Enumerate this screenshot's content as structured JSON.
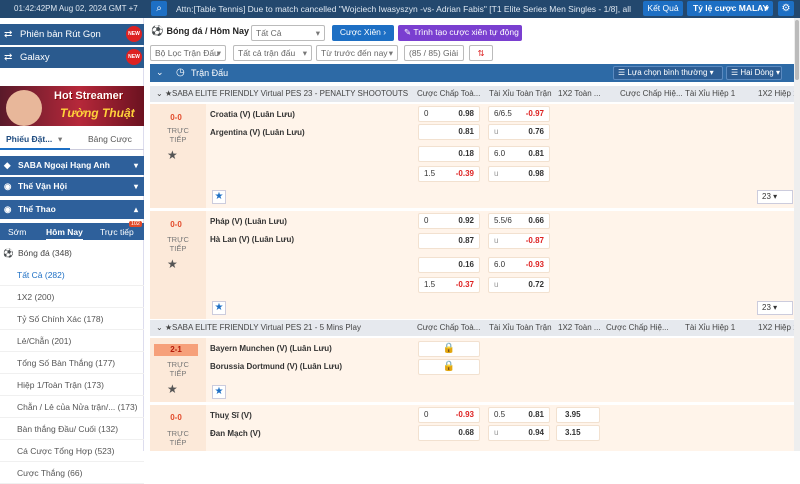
{
  "topbar": {
    "clock": "01:42:42PM Aug 02, 2024 GMT +7",
    "ticker": "Attn:[Table Tennis] Due to match cancelled \"Wojciech Iwasyszyn -vs- Adrian Fabis\" [T1 Elite Series Men Singles - 1/8], all",
    "result_label": "Kết Quả",
    "odds_label": "Tỷ lệ cược MALAY"
  },
  "sidebar": {
    "promo1": "Phiên bản Rút Gọn",
    "promo1_badge": "NEW",
    "promo2": "Galaxy",
    "promo2_badge": "NEW",
    "banner_line1": "Hot Streamer",
    "banner_line2": "Tường Thuật",
    "slip_tab": "Phiếu Đặt...",
    "bet_tab": "Bảng Cược",
    "sections": [
      "SABA Ngoại Hạng Anh",
      "Thế Vận Hội",
      "Thể Thao"
    ],
    "time_tabs": [
      "Sớm",
      "Hôm Nay",
      "Trực tiếp"
    ],
    "live_count": "102",
    "sport": "Bóng đá",
    "sport_count": "(348)",
    "markets": [
      "Tất Cả (282)",
      "1X2 (200)",
      "Tỷ Số Chính Xác (178)",
      "Lẻ/Chẵn (201)",
      "Tổng Số Bàn Thắng (177)",
      "Hiệp 1/Toàn Trận (173)",
      "Chẵn / Lẻ của Nửa trận/... (173)",
      "Bàn thắng Đầu/ Cuối (132)",
      "Cá Cược Tổng Hợp (523)",
      "Cược Thắng (66)"
    ]
  },
  "main": {
    "crumb": "Bóng đá / Hôm Nay",
    "filter_all": "Tất Cả",
    "combo_btn": "Cược Xiên",
    "auto_combo_btn": "Trình tạo cược xiên tự động",
    "filter_league": "Bộ Lọc Trận Đấu",
    "filter_type": "Tất cả trận đấu",
    "filter_sort": "Từ trước đến nay",
    "game_count": "(85 / 85) Giải",
    "header_title": "Trận Đấu",
    "select_normal": "Lựa chọn bình thường",
    "two_lines": "Hai Dòng",
    "columns": [
      "Cược Chấp Toà...",
      "Tài Xỉu Toàn Trận",
      "1X2 Toàn ...",
      "Cược Chấp Hiệ...",
      "Tài Xỉu Hiệp 1",
      "1X2 Hiệp 1"
    ],
    "more_count": "23"
  },
  "leagues": [
    {
      "name": "SABA ELITE FRIENDLY Virtual PES 23 - PENALTY SHOOTOUTS",
      "matches": [
        {
          "score": "0-0",
          "live": "TRỰC TIẾP",
          "home": "Croatia (V) (Luân Lưu)",
          "away": "Argentina (V) (Luân Lưu)",
          "rows": [
            {
              "hdp_line": "0",
              "hdp_odds": "0.98",
              "ou_line": "6/6.5",
              "ou_odds": "-0.97"
            },
            {
              "hdp_line": "",
              "hdp_odds": "0.81",
              "ou_line": "u",
              "ou_odds": "0.76"
            },
            {
              "hdp_line": "",
              "hdp_odds": "0.18",
              "ou_line": "6.0",
              "ou_odds": "0.81"
            },
            {
              "hdp_line": "1.5",
              "hdp_odds": "-0.39",
              "ou_line": "u",
              "ou_odds": "0.98"
            }
          ]
        },
        {
          "score": "0-0",
          "live": "TRỰC TIẾP",
          "home": "Pháp (V) (Luân Lưu)",
          "away": "Hà Lan (V) (Luân Lưu)",
          "rows": [
            {
              "hdp_line": "0",
              "hdp_odds": "0.92",
              "ou_line": "5.5/6",
              "ou_odds": "0.66"
            },
            {
              "hdp_line": "",
              "hdp_odds": "0.87",
              "ou_line": "u",
              "ou_odds": "-0.87"
            },
            {
              "hdp_line": "",
              "hdp_odds": "0.16",
              "ou_line": "6.0",
              "ou_odds": "-0.93"
            },
            {
              "hdp_line": "1.5",
              "hdp_odds": "-0.37",
              "ou_line": "u",
              "ou_odds": "0.72"
            }
          ]
        }
      ]
    },
    {
      "name": "SABA ELITE FRIENDLY Virtual PES 21 - 5 Mins Play",
      "matches": [
        {
          "score": "2-1",
          "live": "TRỰC TIẾP",
          "home": "Bayern Munchen (V) (Luân Lưu)",
          "away": "Borussia Dortmund (V) (Luân Lưu)"
        },
        {
          "score": "0-0",
          "live": "TRỰC TIẾP",
          "home": "Thuỵ Sĩ (V)",
          "away": "Đan Mạch (V)",
          "rows": [
            {
              "hdp_line": "0",
              "hdp_odds": "-0.93",
              "ou_line": "0.5",
              "ou_odds": "0.81",
              "x12": "3.95"
            },
            {
              "hdp_line": "",
              "hdp_odds": "0.68",
              "ou_line": "u",
              "ou_odds": "0.94",
              "x12": "3.15"
            }
          ]
        }
      ]
    }
  ],
  "colors": {
    "topbar": "#23486e",
    "accent": "#1d6fc4",
    "header": "#2d6aa6",
    "negative": "#d22222",
    "match_bg": "#fce9d9"
  }
}
